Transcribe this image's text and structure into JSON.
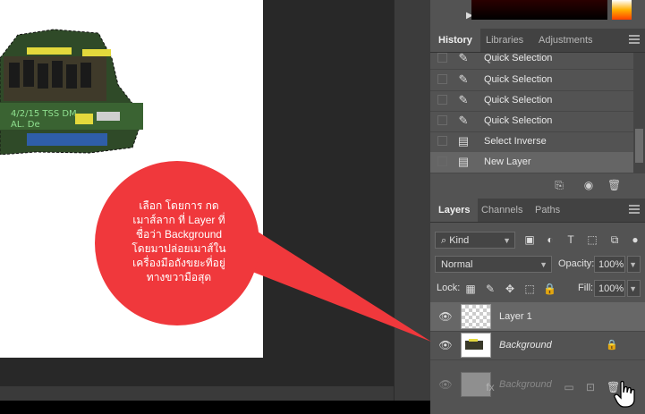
{
  "callout": {
    "lines": [
      "เลือก โดยการ กด",
      "เมาส์ลาก ที่ Layer ที่",
      "ชื่อว่า Background",
      "โดยมาปล่อยเมาส์ใน",
      "เครื่องมือถังขยะที่อยู่",
      "ทางขวามือสุด"
    ],
    "color": "#f0383c"
  },
  "history_panel": {
    "tabs": [
      "History",
      "Libraries",
      "Adjustments"
    ],
    "active_tab": "History",
    "items": [
      {
        "label": "Quick Selection",
        "icon": "quick-selection-brush-icon",
        "selected": false
      },
      {
        "label": "Quick Selection",
        "icon": "quick-selection-brush-icon",
        "selected": false
      },
      {
        "label": "Quick Selection",
        "icon": "quick-selection-brush-icon",
        "selected": false
      },
      {
        "label": "Quick Selection",
        "icon": "quick-selection-brush-icon",
        "selected": false
      },
      {
        "label": "Select Inverse",
        "icon": "history-doc-icon",
        "selected": false
      },
      {
        "label": "New Layer",
        "icon": "history-doc-icon",
        "selected": true
      }
    ],
    "footer_icons": [
      "new-document-from-state-icon",
      "snapshot-camera-icon",
      "trash-icon"
    ]
  },
  "layers_panel": {
    "tabs": [
      "Layers",
      "Channels",
      "Paths"
    ],
    "active_tab": "Layers",
    "filter": {
      "label": "Kind"
    },
    "blend_mode": "Normal",
    "opacity_label": "Opacity:",
    "opacity_value": "100%",
    "lock_label": "Lock:",
    "fill_label": "Fill:",
    "fill_value": "100%",
    "layers": [
      {
        "name": "Layer 1",
        "visible": true,
        "selected": true,
        "transparent": true,
        "locked": false
      },
      {
        "name": "Background",
        "visible": true,
        "selected": false,
        "transparent": false,
        "locked": true
      }
    ],
    "drag_ghost": {
      "name": "Background"
    },
    "footer_icons": [
      "link-icon",
      "fx-icon",
      "mask-icon",
      "adjustment-icon",
      "folder-icon",
      "new-layer-icon",
      "trash-icon"
    ]
  }
}
